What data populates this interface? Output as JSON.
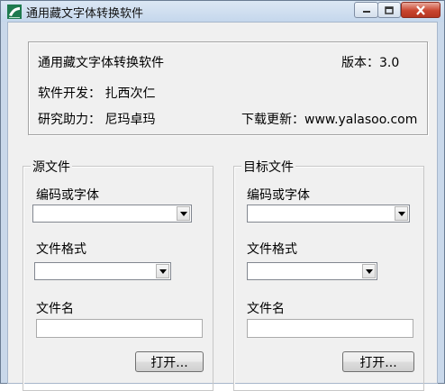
{
  "window": {
    "title": "通用藏文字体转换软件",
    "minimize_icon": "minimize-icon",
    "maximize_icon": "maximize-icon",
    "close_icon": "close-icon",
    "close_color": "#c9452f"
  },
  "info": {
    "app_name": "通用藏文字体转换软件",
    "version": "版本：3.0",
    "developer": "软件开发： 扎西次仁",
    "assistant": "研究助力： 尼玛卓玛",
    "download": "下载更新：www.yalasoo.com"
  },
  "source": {
    "group_title": "源文件",
    "encoding_label": "编码或字体",
    "encoding_value": "",
    "format_label": "文件格式",
    "format_value": "",
    "filename_label": "文件名",
    "filename_value": "",
    "open_button": "打开..."
  },
  "target": {
    "group_title": "目标文件",
    "encoding_label": "编码或字体",
    "encoding_value": "",
    "format_label": "文件格式",
    "format_value": "",
    "filename_label": "文件名",
    "filename_value": "",
    "open_button": "打开..."
  },
  "icons": {
    "app": "app-logo-icon",
    "dropdown": "chevron-down-icon"
  }
}
